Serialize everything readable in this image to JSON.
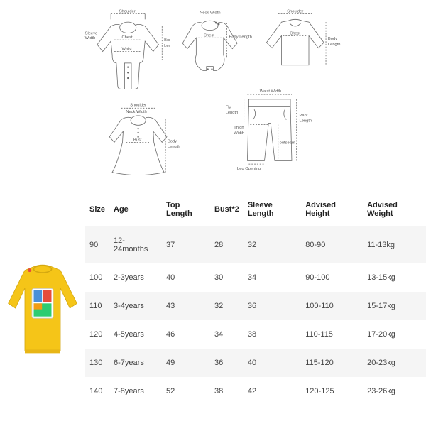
{
  "diagram_labels": {
    "shoulder": "Shoulder",
    "neck_width": "Neck Width",
    "sleeve_width": "Sleeve Width",
    "chest": "Chest",
    "waist": "Waist",
    "body_length": "Body Length",
    "bust": "Bust",
    "waist_width": "Waist Width",
    "fly_length": "Fly Length",
    "thigh_width": "Thigh Width",
    "leg_opening": "Leg Opening",
    "pant_length": "Pant Length",
    "outseam": "outseam",
    "bor_ler": "Bor\nLer"
  },
  "chart_data": {
    "type": "table",
    "headers": [
      "Size",
      "Age",
      "Top Length",
      "Bust*2",
      "Sleeve Length",
      "Advised Height",
      "Advised Weight"
    ],
    "rows": [
      {
        "size": "90",
        "age": "12-24months",
        "top_length": "37",
        "bust2": "28",
        "sleeve_length": "32",
        "advised_height": "80-90",
        "advised_weight": "11-13kg"
      },
      {
        "size": "100",
        "age": "2-3years",
        "top_length": "40",
        "bust2": "30",
        "sleeve_length": "34",
        "advised_height": "90-100",
        "advised_weight": "13-15kg"
      },
      {
        "size": "110",
        "age": "3-4years",
        "top_length": "43",
        "bust2": "32",
        "sleeve_length": "36",
        "advised_height": "100-110",
        "advised_weight": "15-17kg"
      },
      {
        "size": "120",
        "age": "4-5years",
        "top_length": "46",
        "bust2": "34",
        "sleeve_length": "38",
        "advised_height": "110-115",
        "advised_weight": "17-20kg"
      },
      {
        "size": "130",
        "age": "6-7years",
        "top_length": "49",
        "bust2": "36",
        "sleeve_length": "40",
        "advised_height": "115-120",
        "advised_weight": "20-23kg"
      },
      {
        "size": "140",
        "age": "7-8years",
        "top_length": "52",
        "bust2": "38",
        "sleeve_length": "42",
        "advised_height": "120-125",
        "advised_weight": "23-26kg"
      }
    ]
  },
  "product": {
    "color": "#f5c518"
  }
}
